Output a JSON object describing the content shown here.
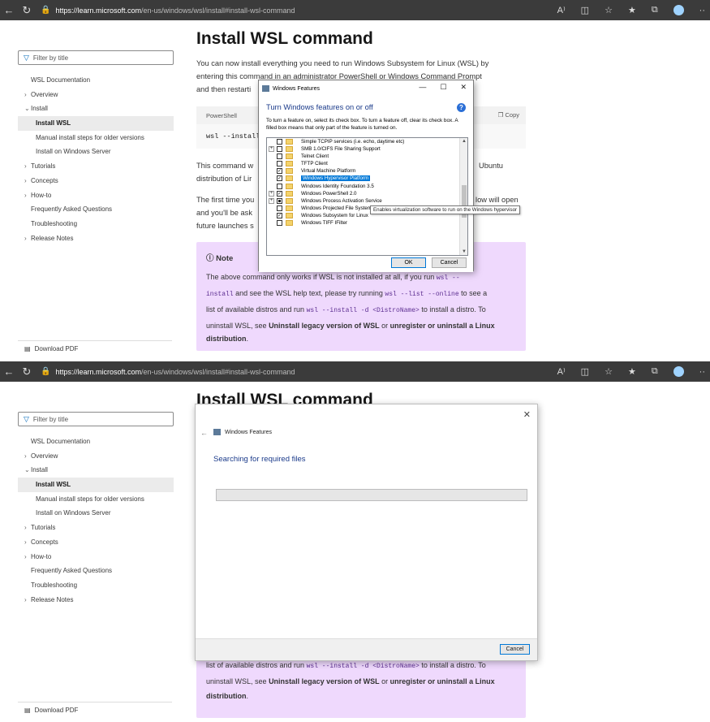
{
  "browser": {
    "url_host": "https://learn.microsoft.com",
    "url_path": "/en-us/windows/wsl/install#install-wsl-command",
    "icons": [
      "back-icon",
      "refresh-icon",
      "lock-icon",
      "read-aloud-icon",
      "split-screen-icon",
      "favorite-add-icon",
      "favorites-icon",
      "collections-icon",
      "profile-icon",
      "more-icon"
    ],
    "read_aloud_label": "A⁾",
    "more_label": "··"
  },
  "sidebar": {
    "filter_placeholder": "Filter by title",
    "items": [
      {
        "label": "WSL Documentation",
        "level": 0,
        "chev": ""
      },
      {
        "label": "Overview",
        "level": 0,
        "chev": "›"
      },
      {
        "label": "Install",
        "level": 0,
        "chev": "⌄"
      },
      {
        "label": "Install WSL",
        "level": 1,
        "active": true
      },
      {
        "label": "Manual install steps for older versions",
        "level": 1
      },
      {
        "label": "Install on Windows Server",
        "level": 1
      },
      {
        "label": "Tutorials",
        "level": 0,
        "chev": "›"
      },
      {
        "label": "Concepts",
        "level": 0,
        "chev": "›"
      },
      {
        "label": "How-to",
        "level": 0,
        "chev": "›"
      },
      {
        "label": "Frequently Asked Questions",
        "level": 0,
        "chev": ""
      },
      {
        "label": "Troubleshooting",
        "level": 0,
        "chev": ""
      },
      {
        "label": "Release Notes",
        "level": 0,
        "chev": "›"
      }
    ],
    "download_pdf": "Download PDF"
  },
  "article": {
    "title": "Install WSL command",
    "p1_line1": "You can now install everything you need to run Windows Subsystem for Linux (WSL) by",
    "p1_line2": "entering this command in an administrator PowerShell or Windows Command Prompt",
    "p1_line3": "and then restarti",
    "code_lang": "PowerShell",
    "code_copy": "Copy",
    "code_text": "wsl --install",
    "p2_line1": "This command w",
    "p2_line1_right": "Ubuntu",
    "p2_line2": "distribution of Lir",
    "p3_line1": "The first time you",
    "p3_line1_right": "low will open",
    "p3_line2": "and you'll be ask",
    "p3_line3": "future launches s",
    "note_title": "Note",
    "note_l1": "The above command only works if WSL is not installed at all, if you run",
    "note_l1_code": "wsl --",
    "note_l2_code": "install",
    "note_l2": "and see the WSL help text, please try running",
    "note_l2_code2": "wsl --list --online",
    "note_l2_end": "to see a",
    "note_l3": "list of available distros and run",
    "note_l3_code": "wsl --install -d <DistroName>",
    "note_l3_end": "to install a distro. To",
    "note_l4": "uninstall WSL, see",
    "note_l4_b1": "Uninstall legacy version of WSL",
    "note_l4_or": "or",
    "note_l4_b2": "unregister or uninstall a Linux",
    "note_l5_b": "distribution",
    "note_l5_dot": "."
  },
  "windows_features": {
    "title": "Windows Features",
    "heading": "Turn Windows features on or off",
    "description": "To turn a feature on, select its check box. To turn a feature off, clear its check box. A filled box means that only part of the feature is turned on.",
    "minimize": "—",
    "maximize": "☐",
    "close": "✕",
    "features": [
      {
        "label": "Simple TCPIP services (i.e. echo, daytime etc)",
        "state": "unchecked",
        "expand": false
      },
      {
        "label": "SMB 1.0/CIFS File Sharing Support",
        "state": "unchecked",
        "expand": true
      },
      {
        "label": "Telnet Client",
        "state": "unchecked",
        "expand": false
      },
      {
        "label": "TFTP Client",
        "state": "unchecked",
        "expand": false
      },
      {
        "label": "Virtual Machine Platform",
        "state": "checked",
        "expand": false
      },
      {
        "label": "Windows Hypervisor Platform",
        "state": "checked",
        "expand": false,
        "selected": true
      },
      {
        "label": "Windows Identity Foundation 3.5",
        "state": "unchecked",
        "expand": false
      },
      {
        "label": "Windows PowerShell 2.0",
        "state": "checked",
        "expand": true
      },
      {
        "label": "Windows Process Activation Service",
        "state": "partial",
        "expand": true
      },
      {
        "label": "Windows Projected File System",
        "state": "unchecked",
        "expand": false
      },
      {
        "label": "Windows Subsystem for Linux",
        "state": "checked",
        "expand": false
      },
      {
        "label": "Windows TIFF IFilter",
        "state": "unchecked",
        "expand": false
      }
    ],
    "tooltip": "Enables virtualization software to run on the Windows hypervisor",
    "ok": "OK",
    "cancel": "Cancel"
  },
  "windows_features_progress": {
    "title": "Windows Features",
    "status": "Searching for required files",
    "progress": 0,
    "close": "✕",
    "back": "←",
    "cancel": "Cancel"
  }
}
